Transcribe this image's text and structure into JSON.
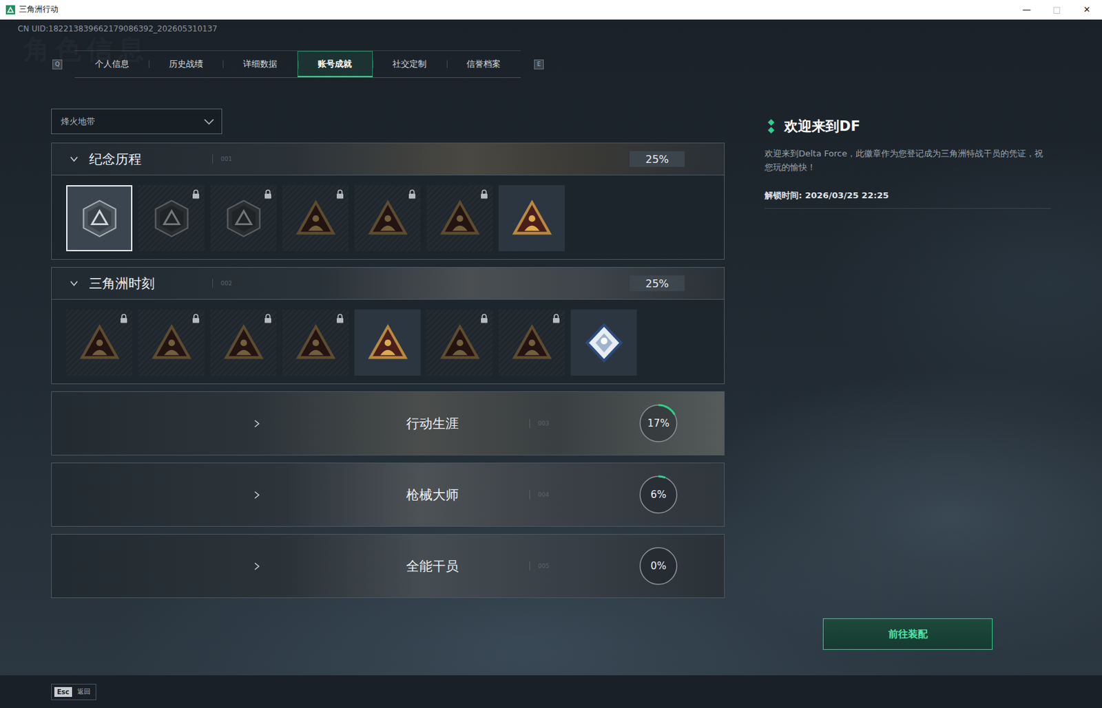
{
  "window": {
    "title": "三角洲行动",
    "controls": [
      {
        "glyph": "—",
        "disabled": false
      },
      {
        "glyph": "□",
        "disabled": true
      },
      {
        "glyph": "✕",
        "disabled": false
      }
    ]
  },
  "uid": "CN UID:182213839662179086392_202605310137",
  "watermark": "角色信息",
  "tabs": {
    "prevKey": "Q",
    "nextKey": "E",
    "items": [
      {
        "label": "个人信息",
        "selected": false
      },
      {
        "label": "历史战绩",
        "selected": false
      },
      {
        "label": "详细数据",
        "selected": false
      },
      {
        "label": "账号成就",
        "selected": true
      },
      {
        "label": "社交定制",
        "selected": false
      },
      {
        "label": "信誉档案",
        "selected": false
      }
    ]
  },
  "modeSelect": {
    "value": "烽火地带"
  },
  "sections": [
    {
      "title": "纪念历程",
      "code": "001",
      "percent": "25%",
      "expanded": true,
      "badges": [
        {
          "kind": "shield",
          "locked": false,
          "selected": true
        },
        {
          "kind": "shield",
          "locked": true,
          "selected": false
        },
        {
          "kind": "shield",
          "locked": true,
          "selected": false
        },
        {
          "kind": "triangle",
          "locked": true,
          "selected": false
        },
        {
          "kind": "triangle",
          "locked": true,
          "selected": false
        },
        {
          "kind": "triangle",
          "locked": true,
          "selected": false
        },
        {
          "kind": "triangle",
          "locked": false,
          "selected": false
        }
      ]
    },
    {
      "title": "三角洲时刻",
      "code": "002",
      "percent": "25%",
      "expanded": true,
      "badges": [
        {
          "kind": "triangle",
          "locked": true,
          "selected": false
        },
        {
          "kind": "triangle",
          "locked": true,
          "selected": false
        },
        {
          "kind": "triangle",
          "locked": true,
          "selected": false
        },
        {
          "kind": "triangle",
          "locked": true,
          "selected": false
        },
        {
          "kind": "triangle",
          "locked": false,
          "selected": false
        },
        {
          "kind": "triangle",
          "locked": true,
          "selected": false
        },
        {
          "kind": "triangle",
          "locked": true,
          "selected": false
        },
        {
          "kind": "diamond",
          "locked": false,
          "selected": false
        }
      ]
    },
    {
      "title": "行动生涯",
      "code": "003",
      "percent": "17%",
      "expanded": false,
      "level": 0.17
    },
    {
      "title": "枪械大师",
      "code": "004",
      "percent": "6%",
      "expanded": false,
      "level": 0.06
    },
    {
      "title": "全能干员",
      "code": "005",
      "percent": "0%",
      "expanded": false,
      "level": 0
    }
  ],
  "detail": {
    "title": "欢迎来到DF",
    "description": "欢迎来到Delta Force，此徽章作为您登记成为三角洲特战干员的凭证，祝您玩的愉快！",
    "unlock": "解锁时间: 2026/03/25 22:25"
  },
  "equipButton": "前往装配",
  "footer": {
    "key": "Esc",
    "label": "返回"
  }
}
